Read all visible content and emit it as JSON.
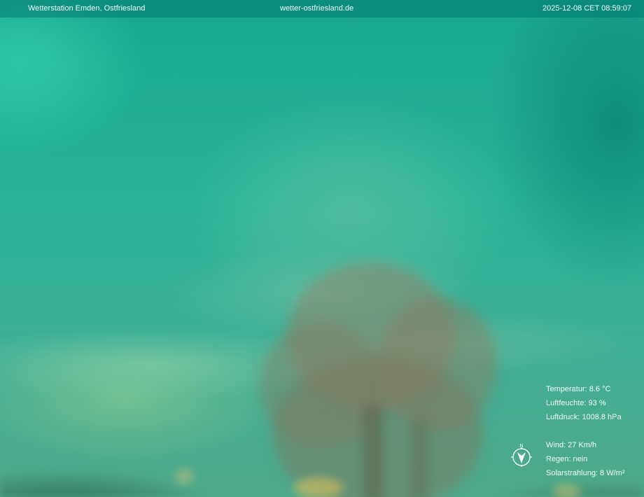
{
  "header": {
    "station": "Wetterstation Emden, Ostfriesland",
    "website": "wetter-ostfriesland.de",
    "timestamp": "2025-12-08 CET 08:59:07"
  },
  "weather": {
    "temperature": "Temperatur: 8.6 °C",
    "humidity": "Luftfeuchte: 93 %",
    "pressure": "Luftdruck: 1008.8 hPa",
    "wind": "Wind: 27 Km/h",
    "rain": "Regen: nein",
    "solar": "Solarstrahlung: 8 W/m²"
  },
  "compass": {
    "icon": "compass-icon",
    "north_label": "N",
    "color": "#ffffff"
  }
}
